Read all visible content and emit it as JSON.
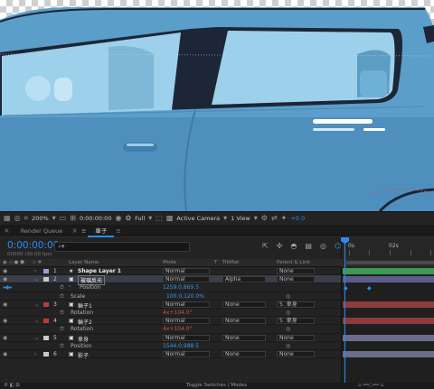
{
  "viewer": {
    "zoom": "200%",
    "timecode": "0:00:00:00",
    "resolution": "Full",
    "camera": "Active Camera",
    "view": "1 View",
    "exposure": "+0.0"
  },
  "tabs": [
    {
      "label": "Render Queue"
    },
    {
      "label": "車子"
    }
  ],
  "timeline": {
    "current_time": "0:00:00:00",
    "frame_info": "00000 (30.00 fps)",
    "search_placeholder": "",
    "ruler_labels": [
      "0s",
      "02s"
    ]
  },
  "columns": {
    "layer_name": "Layer Name",
    "mode": "Mode",
    "t": "T",
    "trkmat": "TrkMat",
    "parent": "Parent & Link"
  },
  "layers": [
    {
      "num": "1",
      "name": "Shape Layer 1",
      "mode": "Normal",
      "trkmat": "",
      "parent": "None",
      "color": "#9b9bd8",
      "bar": "#3e9a56"
    },
    {
      "num": "2",
      "name": "玻璃反光",
      "mode": "Normal",
      "trkmat": "Alpha",
      "parent": "None",
      "color": "#c9c9c9",
      "bar": "#5c5c8c"
    },
    {
      "prop": "Position",
      "value": "1259.0,869.5",
      "color": "#3b95e8"
    },
    {
      "prop": "Scale",
      "value": "100.0,120.0%",
      "color": "#3b95e8"
    },
    {
      "num": "3",
      "name": "輪子1",
      "mode": "Normal",
      "trkmat": "None",
      "parent": "5. 車身",
      "color": "#c03838",
      "bar": "#8c3c3c"
    },
    {
      "prop": "Rotation",
      "value": "4x+104.0°",
      "color": "#cf5050"
    },
    {
      "num": "4",
      "name": "輪子2",
      "mode": "Normal",
      "trkmat": "None",
      "parent": "5. 車身",
      "color": "#c03838",
      "bar": "#8c3c3c"
    },
    {
      "prop": "Rotation",
      "value": "4x+104.0°",
      "color": "#cf5050"
    },
    {
      "num": "5",
      "name": "車身",
      "mode": "Normal",
      "trkmat": "None",
      "parent": "None",
      "color": "#c9c9c9",
      "bar": "#6c6c8c"
    },
    {
      "prop": "Position",
      "value": "1544.0,988.5",
      "color": "#3b95e8"
    },
    {
      "num": "6",
      "name": "影子",
      "mode": "Normal",
      "trkmat": "None",
      "parent": "None",
      "color": "#c9c9c9",
      "bar": "#6c6c8c"
    }
  ],
  "footer": {
    "toggle_label": "Toggle Switches / Modes"
  }
}
